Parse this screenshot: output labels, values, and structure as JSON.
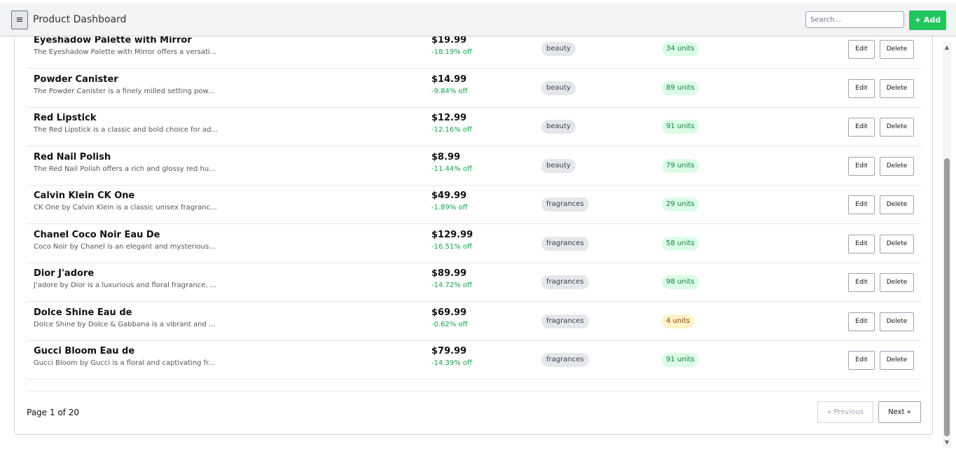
{
  "header": {
    "menu_glyph": "≡",
    "title": "Product Dashboard",
    "search_placeholder": "Search...",
    "add_label": "+ Add"
  },
  "products": [
    {
      "name": "Eyeshadow Palette with Mirror",
      "description": "The Eyeshadow Palette with Mirror offers a versati...",
      "price": "$19.99",
      "discount": "-18.19% off",
      "category": "beauty",
      "stock": "34 units",
      "stock_status": "ok"
    },
    {
      "name": "Powder Canister",
      "description": "The Powder Canister is a finely milled setting pow...",
      "price": "$14.99",
      "discount": "-9.84% off",
      "category": "beauty",
      "stock": "89 units",
      "stock_status": "ok"
    },
    {
      "name": "Red Lipstick",
      "description": "The Red Lipstick is a classic and bold choice for ad...",
      "price": "$12.99",
      "discount": "-12.16% off",
      "category": "beauty",
      "stock": "91 units",
      "stock_status": "ok"
    },
    {
      "name": "Red Nail Polish",
      "description": "The Red Nail Polish offers a rich and glossy red hu...",
      "price": "$8.99",
      "discount": "-11.44% off",
      "category": "beauty",
      "stock": "79 units",
      "stock_status": "ok"
    },
    {
      "name": "Calvin Klein CK One",
      "description": "CK One by Calvin Klein is a classic unisex fragranc...",
      "price": "$49.99",
      "discount": "-1.89% off",
      "category": "fragrances",
      "stock": "29 units",
      "stock_status": "ok"
    },
    {
      "name": "Chanel Coco Noir Eau De",
      "description": "Coco Noir by Chanel is an elegant and mysterious...",
      "price": "$129.99",
      "discount": "-16.51% off",
      "category": "fragrances",
      "stock": "58 units",
      "stock_status": "ok"
    },
    {
      "name": "Dior J'adore",
      "description": "J'adore by Dior is a luxurious and floral fragrance, ...",
      "price": "$89.99",
      "discount": "-14.72% off",
      "category": "fragrances",
      "stock": "98 units",
      "stock_status": "ok"
    },
    {
      "name": "Dolce Shine Eau de",
      "description": "Dolce Shine by Dolce & Gabbana is a vibrant and ...",
      "price": "$69.99",
      "discount": "-0.62% off",
      "category": "fragrances",
      "stock": "4 units",
      "stock_status": "low"
    },
    {
      "name": "Gucci Bloom Eau de",
      "description": "Gucci Bloom by Gucci is a floral and captivating fr...",
      "price": "$79.99",
      "discount": "-14.39% off",
      "category": "fragrances",
      "stock": "91 units",
      "stock_status": "ok"
    }
  ],
  "actions": {
    "edit_label": "Edit",
    "delete_label": "Delete"
  },
  "pagination": {
    "page_info": "Page 1 of 20",
    "prev_label": "« Previous",
    "next_label": "Next »"
  },
  "scrollbar": {
    "up_glyph": "▲",
    "down_glyph": "▼"
  },
  "colors": {
    "accent": "#22c55e",
    "discount": "#16a34a",
    "stock_ok_bg": "#dcfce7",
    "stock_low_bg": "#fef3c7"
  }
}
